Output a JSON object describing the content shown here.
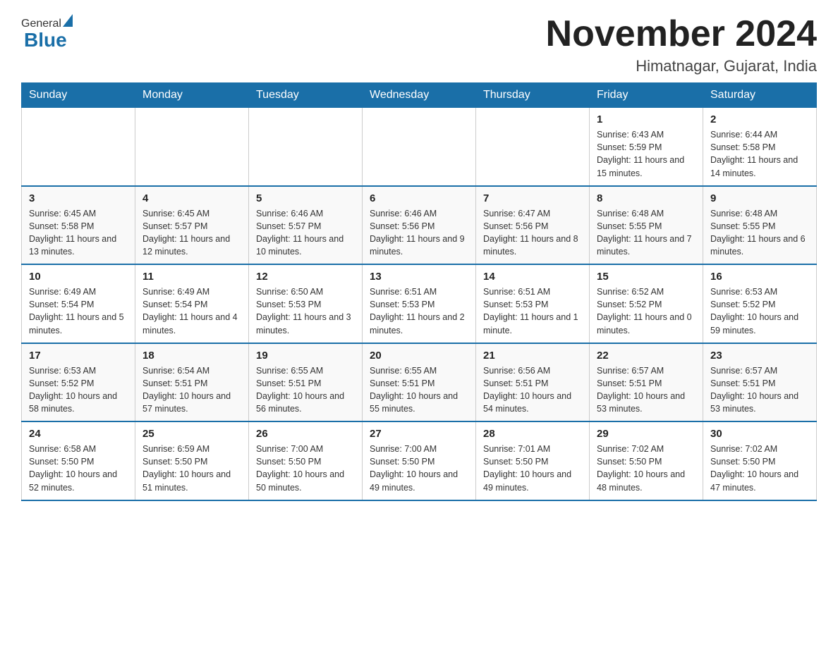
{
  "header": {
    "logo_general": "General",
    "logo_blue": "Blue",
    "month_title": "November 2024",
    "location": "Himatnagar, Gujarat, India"
  },
  "weekdays": [
    "Sunday",
    "Monday",
    "Tuesday",
    "Wednesday",
    "Thursday",
    "Friday",
    "Saturday"
  ],
  "weeks": [
    [
      {
        "day": "",
        "info": ""
      },
      {
        "day": "",
        "info": ""
      },
      {
        "day": "",
        "info": ""
      },
      {
        "day": "",
        "info": ""
      },
      {
        "day": "",
        "info": ""
      },
      {
        "day": "1",
        "info": "Sunrise: 6:43 AM\nSunset: 5:59 PM\nDaylight: 11 hours and 15 minutes."
      },
      {
        "day": "2",
        "info": "Sunrise: 6:44 AM\nSunset: 5:58 PM\nDaylight: 11 hours and 14 minutes."
      }
    ],
    [
      {
        "day": "3",
        "info": "Sunrise: 6:45 AM\nSunset: 5:58 PM\nDaylight: 11 hours and 13 minutes."
      },
      {
        "day": "4",
        "info": "Sunrise: 6:45 AM\nSunset: 5:57 PM\nDaylight: 11 hours and 12 minutes."
      },
      {
        "day": "5",
        "info": "Sunrise: 6:46 AM\nSunset: 5:57 PM\nDaylight: 11 hours and 10 minutes."
      },
      {
        "day": "6",
        "info": "Sunrise: 6:46 AM\nSunset: 5:56 PM\nDaylight: 11 hours and 9 minutes."
      },
      {
        "day": "7",
        "info": "Sunrise: 6:47 AM\nSunset: 5:56 PM\nDaylight: 11 hours and 8 minutes."
      },
      {
        "day": "8",
        "info": "Sunrise: 6:48 AM\nSunset: 5:55 PM\nDaylight: 11 hours and 7 minutes."
      },
      {
        "day": "9",
        "info": "Sunrise: 6:48 AM\nSunset: 5:55 PM\nDaylight: 11 hours and 6 minutes."
      }
    ],
    [
      {
        "day": "10",
        "info": "Sunrise: 6:49 AM\nSunset: 5:54 PM\nDaylight: 11 hours and 5 minutes."
      },
      {
        "day": "11",
        "info": "Sunrise: 6:49 AM\nSunset: 5:54 PM\nDaylight: 11 hours and 4 minutes."
      },
      {
        "day": "12",
        "info": "Sunrise: 6:50 AM\nSunset: 5:53 PM\nDaylight: 11 hours and 3 minutes."
      },
      {
        "day": "13",
        "info": "Sunrise: 6:51 AM\nSunset: 5:53 PM\nDaylight: 11 hours and 2 minutes."
      },
      {
        "day": "14",
        "info": "Sunrise: 6:51 AM\nSunset: 5:53 PM\nDaylight: 11 hours and 1 minute."
      },
      {
        "day": "15",
        "info": "Sunrise: 6:52 AM\nSunset: 5:52 PM\nDaylight: 11 hours and 0 minutes."
      },
      {
        "day": "16",
        "info": "Sunrise: 6:53 AM\nSunset: 5:52 PM\nDaylight: 10 hours and 59 minutes."
      }
    ],
    [
      {
        "day": "17",
        "info": "Sunrise: 6:53 AM\nSunset: 5:52 PM\nDaylight: 10 hours and 58 minutes."
      },
      {
        "day": "18",
        "info": "Sunrise: 6:54 AM\nSunset: 5:51 PM\nDaylight: 10 hours and 57 minutes."
      },
      {
        "day": "19",
        "info": "Sunrise: 6:55 AM\nSunset: 5:51 PM\nDaylight: 10 hours and 56 minutes."
      },
      {
        "day": "20",
        "info": "Sunrise: 6:55 AM\nSunset: 5:51 PM\nDaylight: 10 hours and 55 minutes."
      },
      {
        "day": "21",
        "info": "Sunrise: 6:56 AM\nSunset: 5:51 PM\nDaylight: 10 hours and 54 minutes."
      },
      {
        "day": "22",
        "info": "Sunrise: 6:57 AM\nSunset: 5:51 PM\nDaylight: 10 hours and 53 minutes."
      },
      {
        "day": "23",
        "info": "Sunrise: 6:57 AM\nSunset: 5:51 PM\nDaylight: 10 hours and 53 minutes."
      }
    ],
    [
      {
        "day": "24",
        "info": "Sunrise: 6:58 AM\nSunset: 5:50 PM\nDaylight: 10 hours and 52 minutes."
      },
      {
        "day": "25",
        "info": "Sunrise: 6:59 AM\nSunset: 5:50 PM\nDaylight: 10 hours and 51 minutes."
      },
      {
        "day": "26",
        "info": "Sunrise: 7:00 AM\nSunset: 5:50 PM\nDaylight: 10 hours and 50 minutes."
      },
      {
        "day": "27",
        "info": "Sunrise: 7:00 AM\nSunset: 5:50 PM\nDaylight: 10 hours and 49 minutes."
      },
      {
        "day": "28",
        "info": "Sunrise: 7:01 AM\nSunset: 5:50 PM\nDaylight: 10 hours and 49 minutes."
      },
      {
        "day": "29",
        "info": "Sunrise: 7:02 AM\nSunset: 5:50 PM\nDaylight: 10 hours and 48 minutes."
      },
      {
        "day": "30",
        "info": "Sunrise: 7:02 AM\nSunset: 5:50 PM\nDaylight: 10 hours and 47 minutes."
      }
    ]
  ]
}
